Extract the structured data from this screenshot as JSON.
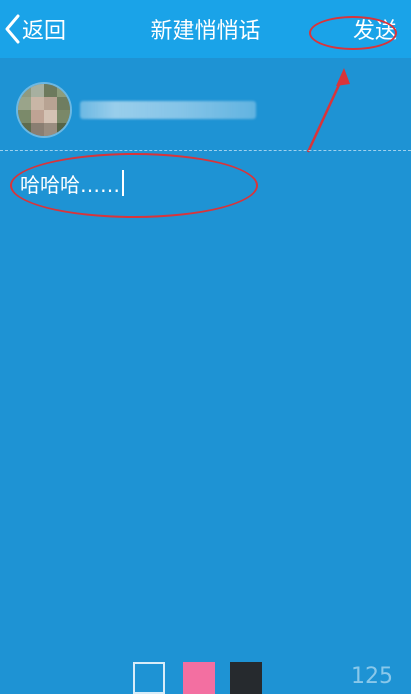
{
  "header": {
    "back_label": "返回",
    "title": "新建悄悄话",
    "send_label": "发送"
  },
  "message": {
    "text": "哈哈哈……"
  },
  "colors": {
    "header_bg": "#1aa3e8",
    "page_bg": "#1e93d4",
    "annotation": "#d9343a",
    "swatch_pink": "#f36fa1",
    "swatch_dark": "#262a2e"
  },
  "footer": {
    "char_count": "125"
  },
  "icons": {
    "back": "chevron-left-icon"
  }
}
